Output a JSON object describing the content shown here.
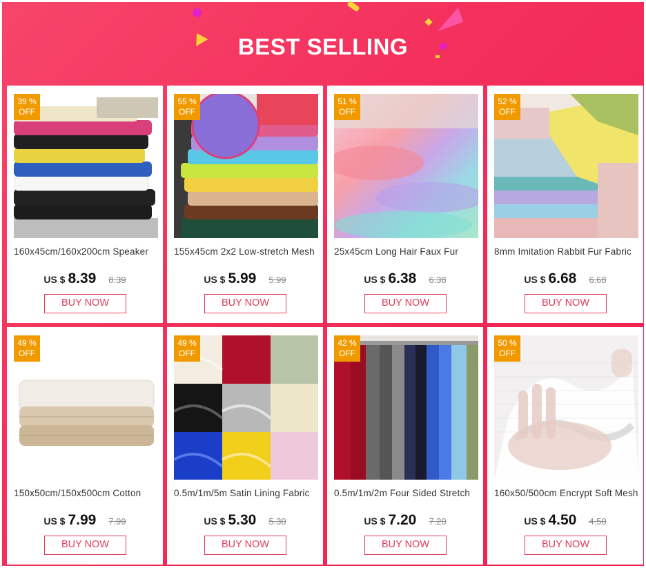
{
  "banner": {
    "title": "BEST SELLING",
    "gradient": [
      "#f7456a",
      "#ee1f4e"
    ],
    "accent": "#e23a5a",
    "badge_color": "#f19a00"
  },
  "products": [
    {
      "discount": "39 %",
      "off": "OFF",
      "name": "160x45cm/160x200cm Speaker",
      "currency": "US $",
      "price": "8.39",
      "old_price": "8.39",
      "button": "BUY NOW",
      "image": "stacked-colorful-mesh-fabric"
    },
    {
      "discount": "55 %",
      "off": "OFF",
      "name": "155x45cm 2x2 Low-stretch Mesh",
      "currency": "US $",
      "price": "5.99",
      "old_price": "5.99",
      "button": "BUY NOW",
      "image": "stacked-mesh-fabric-rolls"
    },
    {
      "discount": "51 %",
      "off": "OFF",
      "name": "25x45cm Long Hair Faux Fur",
      "currency": "US $",
      "price": "6.38",
      "old_price": "6.38",
      "button": "BUY NOW",
      "image": "pastel-faux-fur"
    },
    {
      "discount": "52 %",
      "off": "OFF",
      "name": "8mm Imitation Rabbit Fur Fabric",
      "currency": "US $",
      "price": "6.68",
      "old_price": "6.68",
      "button": "BUY NOW",
      "image": "folded-plush-fabric"
    },
    {
      "discount": "49 %",
      "off": "OFF",
      "name": "150x50cm/150x500cm Cotton",
      "currency": "US $",
      "price": "7.99",
      "old_price": "7.99",
      "button": "BUY NOW",
      "image": "folded-linen-fabric"
    },
    {
      "discount": "49 %",
      "off": "OFF",
      "name": "0.5m/1m/5m Satin Lining Fabric",
      "currency": "US $",
      "price": "5.30",
      "old_price": "5.30",
      "button": "BUY NOW",
      "image": "satin-color-grid"
    },
    {
      "discount": "42 %",
      "off": "OFF",
      "name": "0.5m/1m/2m Four Sided Stretch",
      "currency": "US $",
      "price": "7.20",
      "old_price": "7.20",
      "button": "BUY NOW",
      "image": "hanging-stretch-fabric"
    },
    {
      "discount": "50 %",
      "off": "OFF",
      "name": "160x50/500cm Encrypt Soft Mesh",
      "currency": "US $",
      "price": "4.50",
      "old_price": "4.50",
      "button": "BUY NOW",
      "image": "hand-with-white-mesh"
    }
  ]
}
